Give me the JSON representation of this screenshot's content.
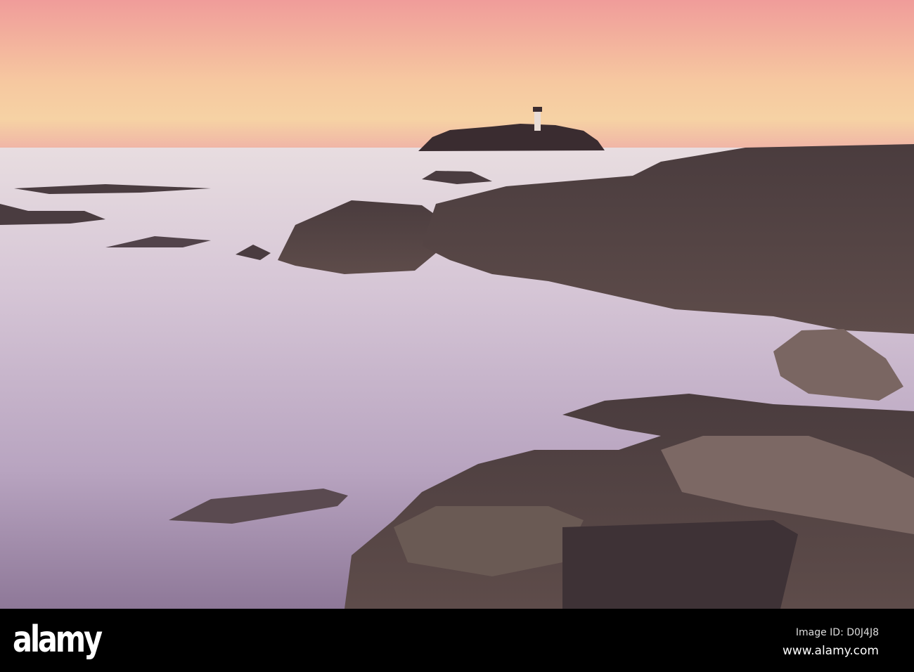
{
  "photo": {
    "subject": "Lighthouse on island at sunset over rocky shore",
    "colors": {
      "sky_top": "#f2a49c",
      "sky_mid": "#f6cc9e",
      "horizon": "#f2b8a4",
      "sea_light": "#e6d6e0",
      "sea_dark": "#9c86a8",
      "rock": "#4e4040",
      "rock_light": "#7a6660"
    }
  },
  "watermark": {
    "logo": "alamy",
    "image_id": "Image ID: D0J4J8",
    "url": "www.alamy.com"
  }
}
